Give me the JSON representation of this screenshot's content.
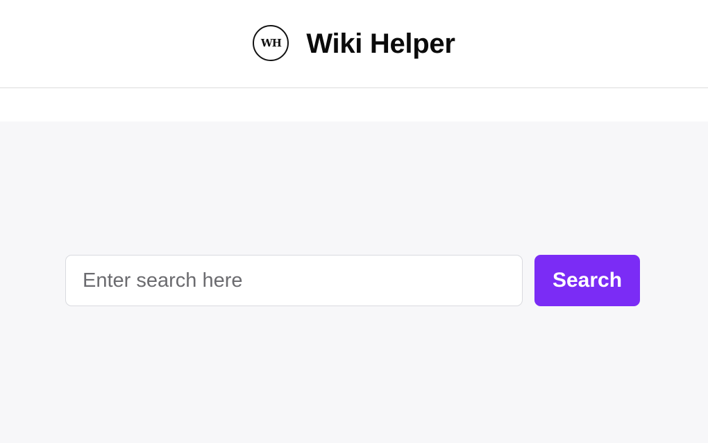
{
  "header": {
    "logo_text": "WH",
    "title": "Wiki Helper"
  },
  "search": {
    "placeholder": "Enter search here",
    "value": "",
    "button_label": "Search"
  },
  "colors": {
    "accent": "#7b2cf5",
    "main_background": "#f7f7f9",
    "header_background": "#ffffff"
  }
}
